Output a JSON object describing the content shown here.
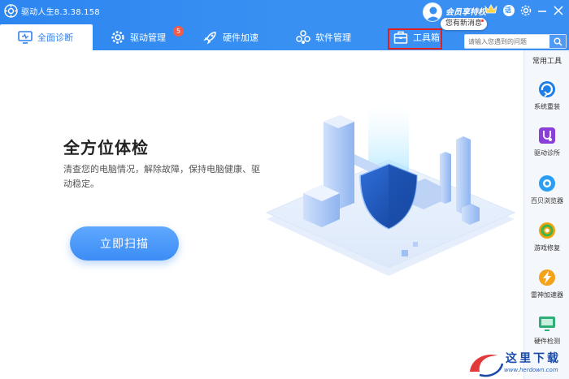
{
  "window": {
    "title": "驱动人生8.3.38.158"
  },
  "account": {
    "vip_label": "会员享特权",
    "message_badge": "您有新消息",
    "user_badge": "话"
  },
  "nav": {
    "tabs": [
      {
        "label": "全面诊断",
        "icon": "monitor-icon",
        "active": true
      },
      {
        "label": "驱动管理",
        "icon": "gear-icon",
        "badge": "5"
      },
      {
        "label": "硬件加速",
        "icon": "rocket-icon"
      },
      {
        "label": "软件管理",
        "icon": "apps-icon"
      },
      {
        "label": "工具箱",
        "icon": "toolbox-icon",
        "highlighted": true
      }
    ]
  },
  "search": {
    "placeholder": "请输入您遇到的问题"
  },
  "main": {
    "title": "全方位体检",
    "subtitle": "清查您的电脑情况，解除故障，保持电脑健康、驱动稳定。",
    "scan_button": "立即扫描"
  },
  "sidebar": {
    "heading": "常用工具",
    "items": [
      {
        "label": "系统重装",
        "icon": "system-reinstall-icon"
      },
      {
        "label": "驱动诊所",
        "icon": "driver-clinic-icon"
      },
      {
        "label": "百贝浏览器",
        "icon": "browser-icon"
      },
      {
        "label": "游戏修复",
        "icon": "game-repair-icon"
      },
      {
        "label": "雷神加速器",
        "icon": "accelerator-icon"
      },
      {
        "label": "硬件检测",
        "icon": "hardware-check-icon"
      }
    ]
  },
  "watermark": {
    "text": "这里下载",
    "url": "www.herdown.com"
  },
  "colors": {
    "header": "#3a8ff2",
    "accent": "#2f7ff0",
    "highlight_border": "#e02020",
    "badge": "#f55b4a"
  }
}
